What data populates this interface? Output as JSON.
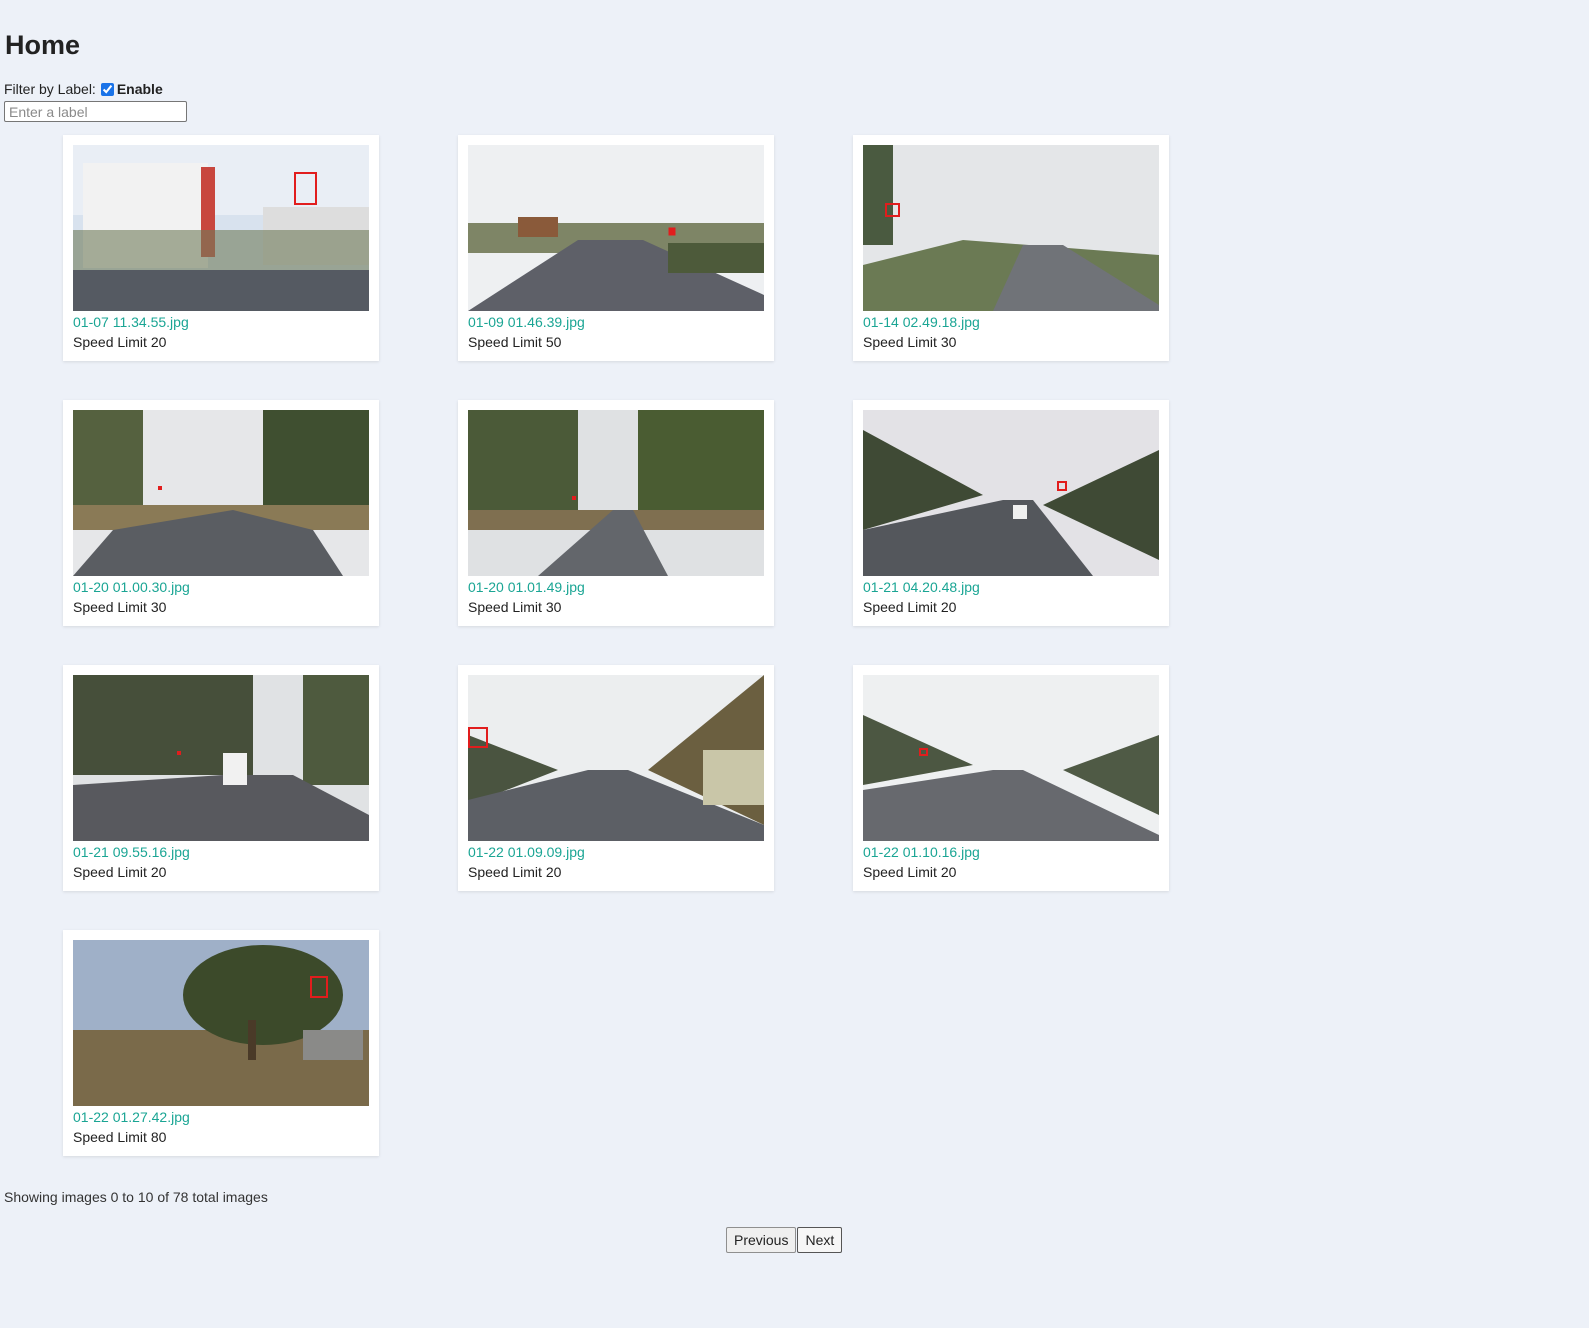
{
  "page": {
    "title": "Home"
  },
  "filter": {
    "label": "Filter by Label:",
    "enable_label": "Enable",
    "enabled": true,
    "placeholder": "Enter a label"
  },
  "images": [
    {
      "filename": "01-07 11.34.55.jpg",
      "label": "Speed Limit 20"
    },
    {
      "filename": "01-09 01.46.39.jpg",
      "label": "Speed Limit 50"
    },
    {
      "filename": "01-14 02.49.18.jpg",
      "label": "Speed Limit 30"
    },
    {
      "filename": "01-20 01.00.30.jpg",
      "label": "Speed Limit 30"
    },
    {
      "filename": "01-20 01.01.49.jpg",
      "label": "Speed Limit 30"
    },
    {
      "filename": "01-21 04.20.48.jpg",
      "label": "Speed Limit 20"
    },
    {
      "filename": "01-21 09.55.16.jpg",
      "label": "Speed Limit 20"
    },
    {
      "filename": "01-22 01.09.09.jpg",
      "label": "Speed Limit 20"
    },
    {
      "filename": "01-22 01.10.16.jpg",
      "label": "Speed Limit 20"
    },
    {
      "filename": "01-22 01.27.42.jpg",
      "label": "Speed Limit 80"
    }
  ],
  "summary": "Showing images 0 to 10 of 78 total images",
  "pagination": {
    "previous_label": "Previous",
    "next_label": "Next"
  },
  "colors": {
    "link": "#1aa594",
    "background": "#edf1f8",
    "bbox": "#e11d1d"
  }
}
